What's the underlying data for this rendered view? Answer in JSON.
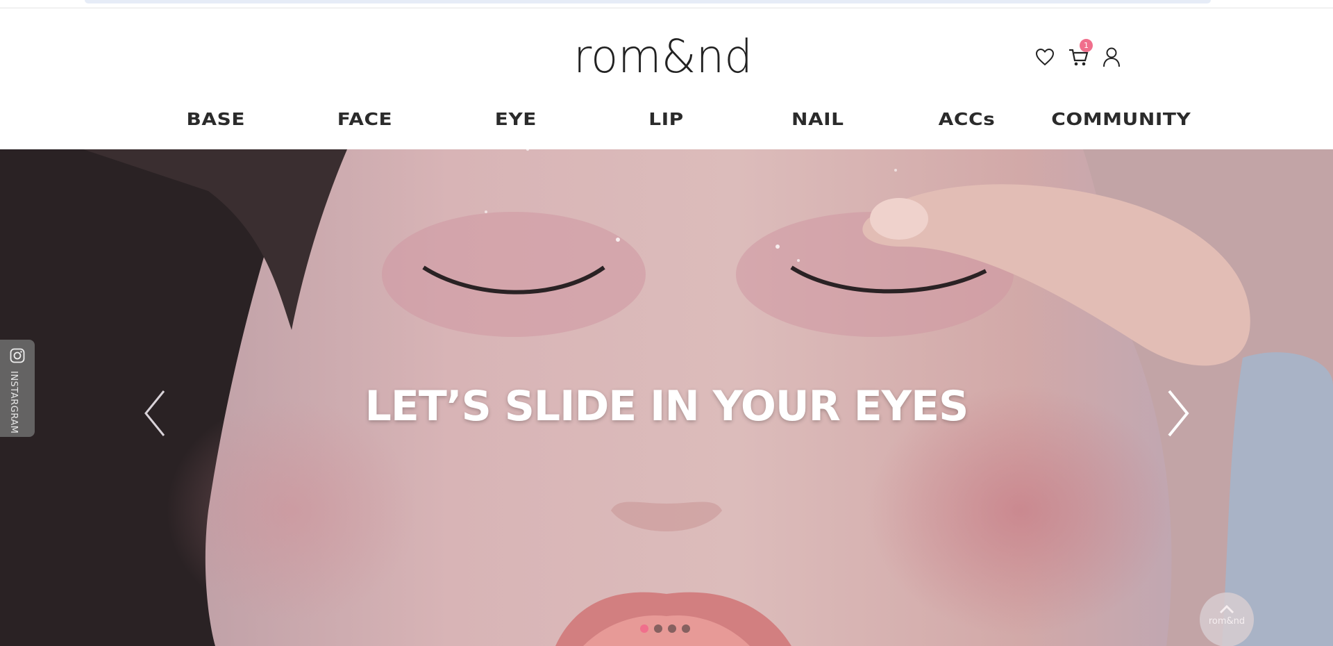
{
  "brand": {
    "logo_text": "rom&nd"
  },
  "header": {
    "cart_count": "1",
    "icons": [
      "heart-icon",
      "cart-icon",
      "user-icon"
    ]
  },
  "nav": {
    "items": [
      {
        "label": "BASE"
      },
      {
        "label": "FACE"
      },
      {
        "label": "EYE"
      },
      {
        "label": "LIP"
      },
      {
        "label": "NAIL"
      },
      {
        "label": "ACCs"
      },
      {
        "label": "COMMUNITY"
      }
    ]
  },
  "hero": {
    "caption": "LET’S SLIDE IN YOUR EYES",
    "slides_total": 4,
    "active_slide": 1
  },
  "sidebar": {
    "instagram_label": "INSTARGRAM"
  },
  "scroll_top": {
    "brand_text": "rom&nd"
  },
  "colors": {
    "accent": "#f06f8c",
    "nav_text": "#2b2b2b",
    "strip": "#e6ecf7"
  }
}
